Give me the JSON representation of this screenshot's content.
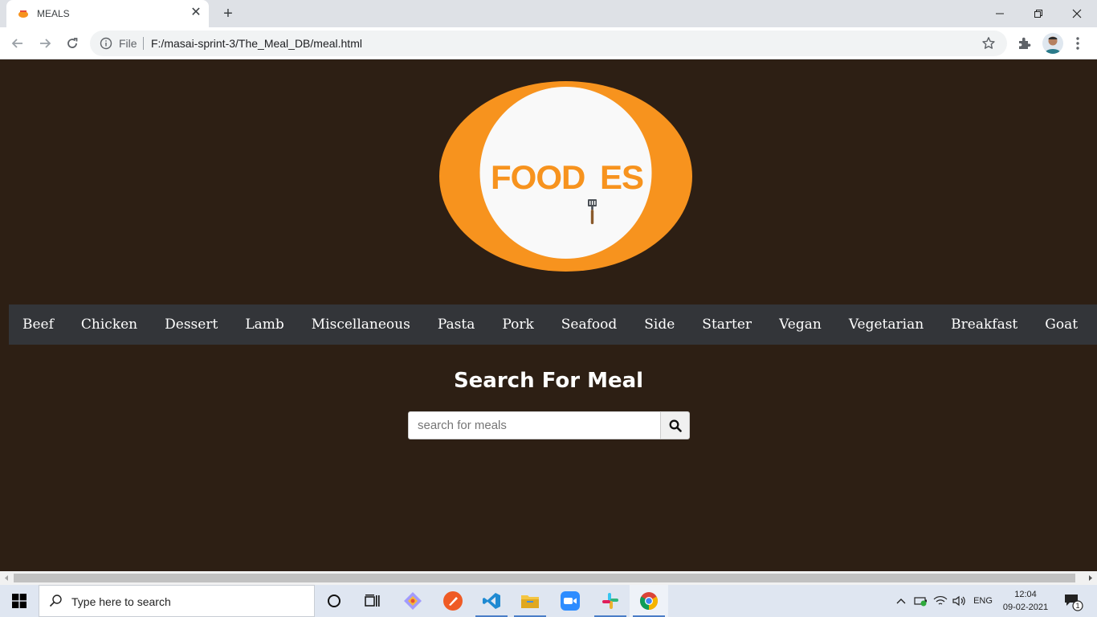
{
  "browser": {
    "tab_title": "MEALS",
    "tab_close": "✕",
    "new_tab": "+",
    "scheme_label": "File",
    "url": "F:/masai-sprint-3/The_Meal_DB/meal.html"
  },
  "logo": {
    "text_left": "FOOD",
    "text_right": "ES",
    "colors": {
      "ring": "#f7931e",
      "center": "#f9f9f9"
    }
  },
  "categories": [
    "Beef",
    "Chicken",
    "Dessert",
    "Lamb",
    "Miscellaneous",
    "Pasta",
    "Pork",
    "Seafood",
    "Side",
    "Starter",
    "Vegan",
    "Vegetarian",
    "Breakfast",
    "Goat"
  ],
  "search": {
    "title": "Search For Meal",
    "placeholder": "search for meals",
    "value": ""
  },
  "taskbar": {
    "search_placeholder": "Type here to search",
    "lang": "ENG",
    "time": "12:04",
    "date": "09-02-2021",
    "notification_count": "1"
  },
  "colors": {
    "page_bg": "#2d1f14",
    "nav_bg": "#333539",
    "accent": "#f7931e"
  }
}
